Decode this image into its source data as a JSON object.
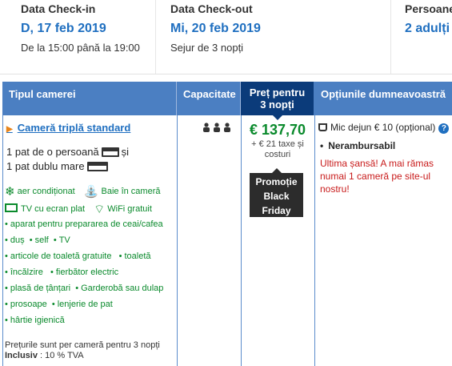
{
  "checkin": {
    "label": "Data Check-in",
    "date": "D, 17 feb 2019",
    "time": "De la 15:00 până la 19:00"
  },
  "checkout": {
    "label": "Data Check-out",
    "date": "Mi, 20 feb 2019",
    "stay": "Sejur de 3 nopți"
  },
  "guests": {
    "label": "Persoane",
    "value": "2 adulți"
  },
  "table": {
    "col_room": "Tipul camerei",
    "col_capacity": "Capacitate",
    "col_price_line1": "Preț pentru",
    "col_price_line2": "3 nopți",
    "col_options": "Opțiunile dumneavoastră"
  },
  "room": {
    "name": "Cameră triplă standard",
    "bed1": "1 pat de o persoană",
    "bed_and": "și",
    "bed2": "1 pat dublu mare",
    "capacity_icon": "person-icon x3",
    "facilities_row1": [
      "aer condiționat",
      "Baie în cameră"
    ],
    "facilities_row2": [
      "TV cu ecran plat",
      "WiFi gratuit"
    ],
    "amenities": [
      [
        "aparat pentru prepararea de ceai/cafea"
      ],
      [
        "duș",
        "self",
        "TV"
      ],
      [
        "articole de toaletă gratuite",
        "toaletă"
      ],
      [
        "încălzire",
        "fierbător electric"
      ],
      [
        "plasă de țânțari",
        "Garderobă sau dulap"
      ],
      [
        "prosoape",
        "lenjerie de pat"
      ],
      [
        "hârtie igienică"
      ]
    ],
    "note_line1": "Prețurile sunt per cameră pentru 3 nopți",
    "note_bold": "Inclusiv",
    "note_tax": " : 10 % TVA"
  },
  "price": {
    "value": "€ 137,70",
    "tax_line1": "+ € 21 taxe și",
    "tax_line2": "costuri",
    "promo_line1": "Promoție",
    "promo_line2": "Black",
    "promo_line3": "Friday"
  },
  "options": {
    "breakfast": "Mic dejun € 10 (opțional)",
    "refund": "Nerambursabil",
    "warning": "Ultima șansă! A mai rămas numai 1 cameră pe site-ul nostru!"
  },
  "colors": {
    "link": "#1f6fc0",
    "green": "#0a8a2c",
    "header": "#4b7fc2",
    "price_header": "#0b3b7a",
    "warning": "#c81a1a"
  }
}
